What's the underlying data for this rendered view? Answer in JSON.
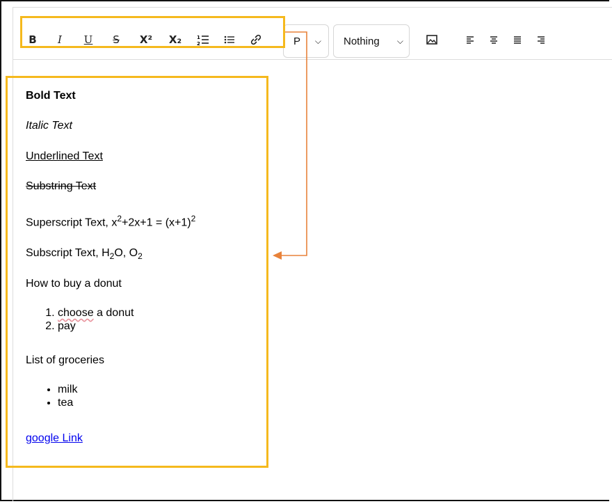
{
  "toolbar": {
    "bold": "B",
    "italic": "I",
    "underline": "U",
    "strike": "S",
    "superscript": "X²",
    "subscript": "X₂",
    "block_format": "P",
    "font_select": "Nothing"
  },
  "content": {
    "bold_text": "Bold Text",
    "italic_text": "Italic Text",
    "underline_text": "Underlined Text",
    "strike_text": "Substring Text",
    "sup_prefix": "Superscript Text, x",
    "sup_exp1": "2",
    "sup_mid": "+2x+1 = (x+1)",
    "sup_exp2": "2",
    "sub_prefix": "Subscript Text, H",
    "sub_1": "2",
    "sub_mid": "O, O",
    "sub_2": "2",
    "ordered_heading": "How to buy a donut",
    "ordered_items": [
      "choose",
      "a donut",
      "pay"
    ],
    "bullet_heading": "List of groceries",
    "bullet_items": [
      "milk",
      "tea"
    ],
    "link_text": "google Link"
  },
  "colors": {
    "highlight": "#f5b91d",
    "arrow": "#e8823a",
    "link": "#0000ee"
  },
  "icons": [
    "bold-icon",
    "italic-icon",
    "underline-icon",
    "strikethrough-icon",
    "superscript-icon",
    "subscript-icon",
    "ordered-list-icon",
    "bullet-list-icon",
    "link-icon",
    "image-icon",
    "align-left-icon",
    "align-center-icon",
    "align-justify-icon",
    "align-right-icon",
    "chevron-down-icon"
  ]
}
